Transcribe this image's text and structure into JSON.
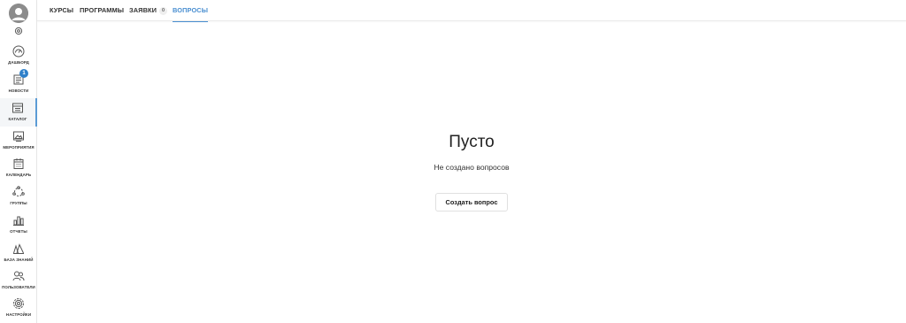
{
  "sidebar": {
    "items": [
      {
        "label": "ДАШБОРД",
        "icon": "dashboard-icon"
      },
      {
        "label": "НОВОСТИ",
        "icon": "news-icon",
        "badge": "1"
      },
      {
        "label": "КАТАЛОГ",
        "icon": "catalog-icon",
        "active": true
      },
      {
        "label": "МЕРОПРИЯТИЯ",
        "icon": "events-icon"
      },
      {
        "label": "КАЛЕНДАРЬ",
        "icon": "calendar-icon"
      },
      {
        "label": "ГРУППЫ",
        "icon": "groups-icon"
      },
      {
        "label": "ОТЧЕТЫ",
        "icon": "reports-icon"
      },
      {
        "label": "БАЗА ЗНАНИЙ",
        "icon": "knowledge-base-icon"
      },
      {
        "label": "ПОЛЬЗОВАТЕЛИ",
        "icon": "users-icon"
      },
      {
        "label": "НАСТРОЙКИ",
        "icon": "settings-icon"
      }
    ]
  },
  "tabs": [
    {
      "label": "КУРСЫ"
    },
    {
      "label": "ПРОГРАММЫ"
    },
    {
      "label": "ЗАЯВКИ",
      "count": "0"
    },
    {
      "label": "ВОПРОСЫ",
      "active": true
    }
  ],
  "empty_state": {
    "title": "Пусто",
    "subtitle": "Не создано вопросов",
    "button_label": "Создать вопрос"
  },
  "colors": {
    "accent": "#4a8fd1",
    "badge": "#2f80c9",
    "avatar": "#8c8c8c"
  }
}
